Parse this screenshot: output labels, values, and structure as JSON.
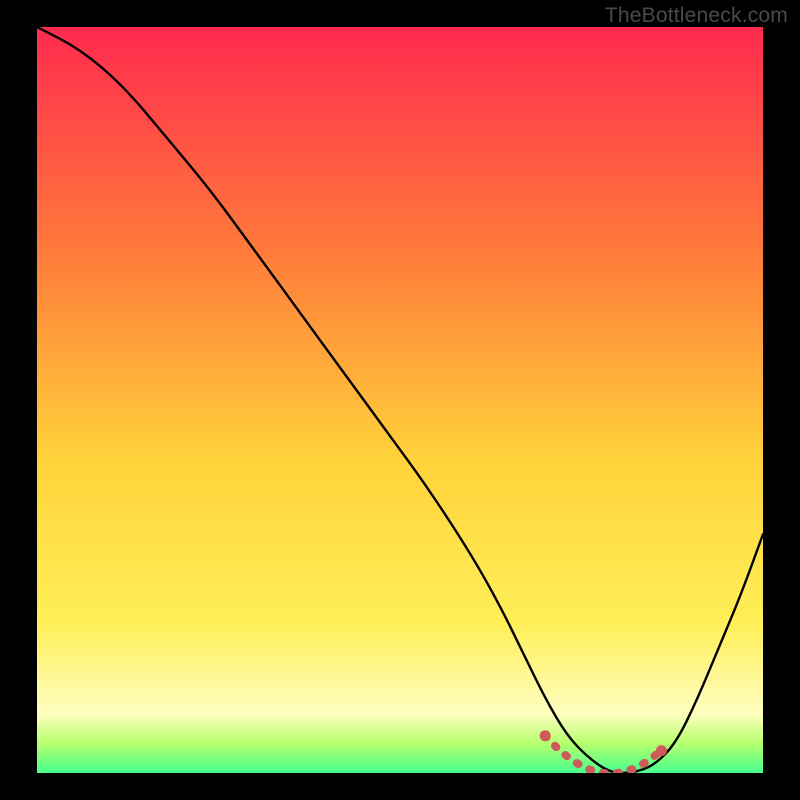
{
  "watermark": "TheBottleneck.com",
  "colors": {
    "bg": "#000000",
    "grad_top": "#ff2a4e",
    "grad_mid1": "#ff7a3a",
    "grad_mid2": "#ffd23a",
    "grad_mid3": "#ffef58",
    "grad_low": "#fffec0",
    "grad_green1": "#b6ff6e",
    "grad_green2": "#47ff8e",
    "curve": "#000000",
    "marker": "#cf5a5a"
  },
  "chart_data": {
    "type": "line",
    "title": "",
    "xlabel": "",
    "ylabel": "",
    "xlim": [
      0,
      100
    ],
    "ylim": [
      0,
      100
    ],
    "series": [
      {
        "name": "bottleneck-curve",
        "x": [
          0,
          6,
          12,
          18,
          24,
          30,
          36,
          42,
          48,
          54,
          60,
          64,
          67,
          70,
          73,
          76,
          79,
          82,
          85,
          88,
          91,
          94,
          97,
          100
        ],
        "y": [
          100,
          97,
          92,
          85,
          78,
          70,
          62,
          54,
          46,
          38,
          29,
          22,
          16,
          10,
          5,
          2,
          0,
          0,
          1,
          4,
          10,
          17,
          24,
          32
        ]
      }
    ],
    "markers": {
      "name": "optimal-band",
      "x": [
        70,
        72,
        74,
        76,
        78,
        80,
        82,
        84,
        86
      ],
      "y": [
        5,
        3,
        1.5,
        0.5,
        0,
        0,
        0.5,
        1.5,
        3
      ]
    }
  }
}
